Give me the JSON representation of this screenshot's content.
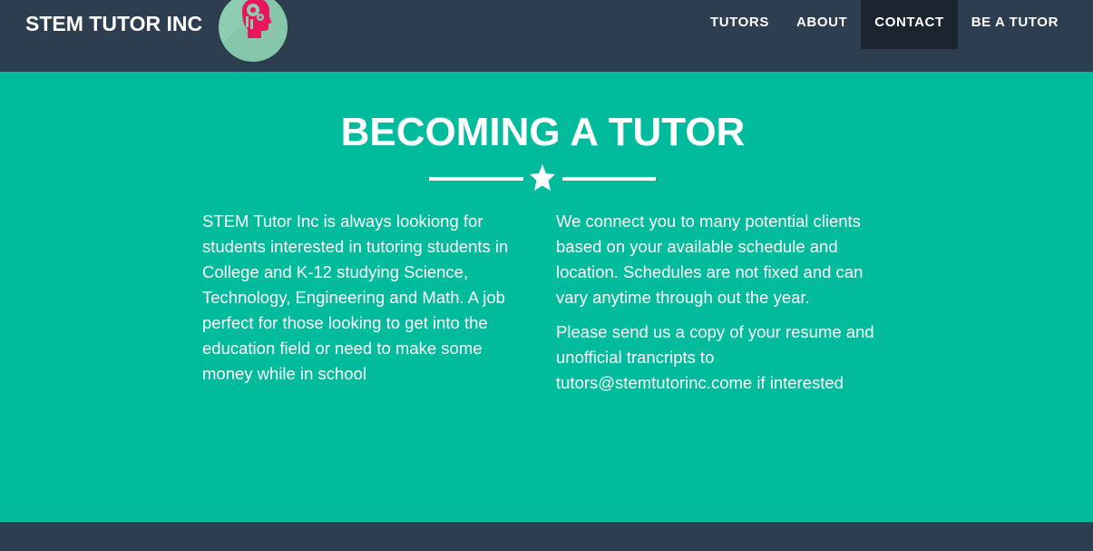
{
  "header": {
    "brand": "STEM TUTOR INC",
    "logo_icon": "brain-head-icon",
    "nav": [
      {
        "label": "TUTORS",
        "active": false
      },
      {
        "label": "ABOUT",
        "active": false
      },
      {
        "label": "CONTACT",
        "active": true
      },
      {
        "label": "BE A TUTOR",
        "active": false
      }
    ]
  },
  "main": {
    "title": "BECOMING A TUTOR",
    "divider_icon": "star-icon",
    "left_paragraphs": [
      "STEM Tutor Inc is always lookiong for students interested in tutoring students in College and K-12 studying Science, Technology, Engineering and Math. A job perfect for those looking to get into the education field or need to make some money while in school"
    ],
    "right_paragraphs": [
      "We connect you to many potential clients based on your available schedule and location. Schedules are not fixed and can vary anytime through out the year.",
      "Please send us a copy of your resume and unofficial trancripts to tutors@stemtutorinc.come if interested"
    ]
  },
  "colors": {
    "navbar": "#2c3e50",
    "accent": "#00bc9c",
    "active_nav": "#1a252f",
    "logo_bg": "#8fcdb3",
    "logo_head": "#e8175d"
  }
}
